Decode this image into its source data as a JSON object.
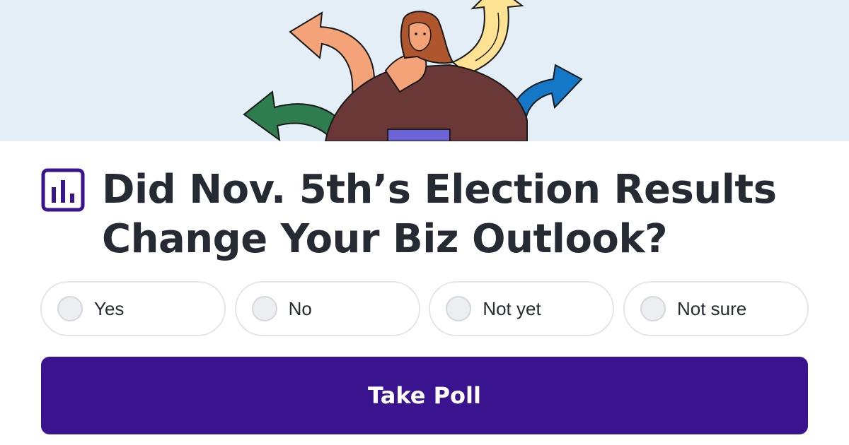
{
  "banner": {
    "illustration": "woman-thinking-with-arrows",
    "background_color": "#e3eef7"
  },
  "poll": {
    "icon": "bar-chart-icon",
    "title": "Did Nov. 5th’s Election Results Change Your Biz Outlook?",
    "options": [
      {
        "label": "Yes",
        "selected": false
      },
      {
        "label": "No",
        "selected": false
      },
      {
        "label": "Not yet",
        "selected": false
      },
      {
        "label": "Not sure",
        "selected": false
      }
    ],
    "submit_label": "Take Poll"
  },
  "colors": {
    "accent": "#3a148f",
    "title_text": "#262b33",
    "arrow_orange": "#f4a277",
    "arrow_yellow": "#fde294",
    "arrow_green": "#2e7d4f",
    "arrow_blue": "#1477c8"
  }
}
